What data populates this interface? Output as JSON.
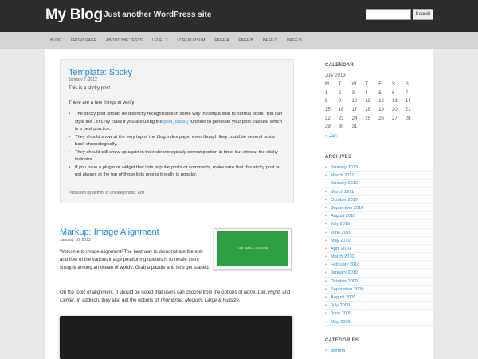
{
  "header": {
    "site_title": "My Blog",
    "site_description": "Just another WordPress site",
    "search_button": "Search"
  },
  "nav": {
    "items": [
      "BLOG",
      "FRONT PAGE",
      "ABOUT THE TESTS",
      "LEVEL 1",
      "LOREM IPSUM",
      "PAGE A",
      "PAGE B",
      "PAGE C",
      "PAGE D"
    ]
  },
  "sticky_post": {
    "title": "Template: Sticky",
    "date": "January 7, 2012",
    "intro": "This is a sticky post.",
    "verify": "There are a few things to verify:",
    "bullet1_a": "The sticky post should be distinctly recognizable in some way in comparison to normal posts. You can style the ",
    "bullet1_code": ".sticky",
    "bullet1_b": " class if you are using the ",
    "bullet1_link": "post_class()",
    "bullet1_c": " function to generate your post classes, which is a best practice.",
    "bullet2": "They should show at the very top of the blog index page, even though they could be several posts back chronologically.",
    "bullet3": "They should still show up again in their chronologically correct postion in time, but without the sticky indicator.",
    "bullet4": "If you have a plugin or widget that lists popular posts or comments, make sure that this sticky post is not always at the top of those lists unless it really is popular.",
    "meta": "Published by admin, in Uncategorized. Edit"
  },
  "markup_post": {
    "title": "Markup: Image Alignment",
    "date": "January 10, 2013",
    "p1": "Welcome to image alignment! The best way to demonstrate the ebb and flow of the various image positioning options is to nestle them snuggly among an ocean of words. Grab a paddle and let's get started.",
    "p2_a": "On the topic of alignment, it should be noted that users can choose from the options of ",
    "p2_none": "None",
    "p2_sep1": ", ",
    "p2_left": "Left",
    "p2_sep2": ", ",
    "p2_right": "Right",
    "p2_and": ", and ",
    "p2_center": "Center",
    "p2_b": ". In addition, they also get the options of ",
    "p2_thumb": "Thumbnail",
    "p2_sep3": ", ",
    "p2_medium": "Medium",
    "p2_sep4": ", ",
    "p2_large": "Large",
    "p2_amp": " & ",
    "p2_full": "Fullsize",
    "p2_end": ".",
    "green_image_text": "I AM SMALL ON SIDE"
  },
  "calendar": {
    "widget_title": "CALENDAR",
    "caption": "July 2013",
    "day_headers": [
      "M",
      "T",
      "W",
      "T",
      "F",
      "S",
      "S"
    ],
    "weeks": [
      [
        "1",
        "2",
        "3",
        "4",
        "5",
        "6",
        "7"
      ],
      [
        "8",
        "9",
        "10",
        "11",
        "12",
        "13",
        "14"
      ],
      [
        "15",
        "16",
        "17",
        "18",
        "19",
        "20",
        "21"
      ],
      [
        "22",
        "23",
        "24",
        "25",
        "26",
        "27",
        "28"
      ],
      [
        "29",
        "30",
        "31",
        "",
        "",
        "",
        ""
      ]
    ],
    "prev_link": "« Jan"
  },
  "archives": {
    "widget_title": "ARCHIVES",
    "items": [
      "January 2013",
      "March 2012",
      "January 2012",
      "March 2011",
      "October 2010",
      "September 2010",
      "August 2010",
      "July 2010",
      "June 2010",
      "May 2010",
      "April 2010",
      "March 2010",
      "February 2010",
      "January 2010",
      "October 2009",
      "September 2009",
      "August 2009",
      "July 2009",
      "June 2009",
      "May 2009"
    ]
  },
  "categories": {
    "widget_title": "CATEGORIES",
    "items": [
      "aciform"
    ]
  }
}
